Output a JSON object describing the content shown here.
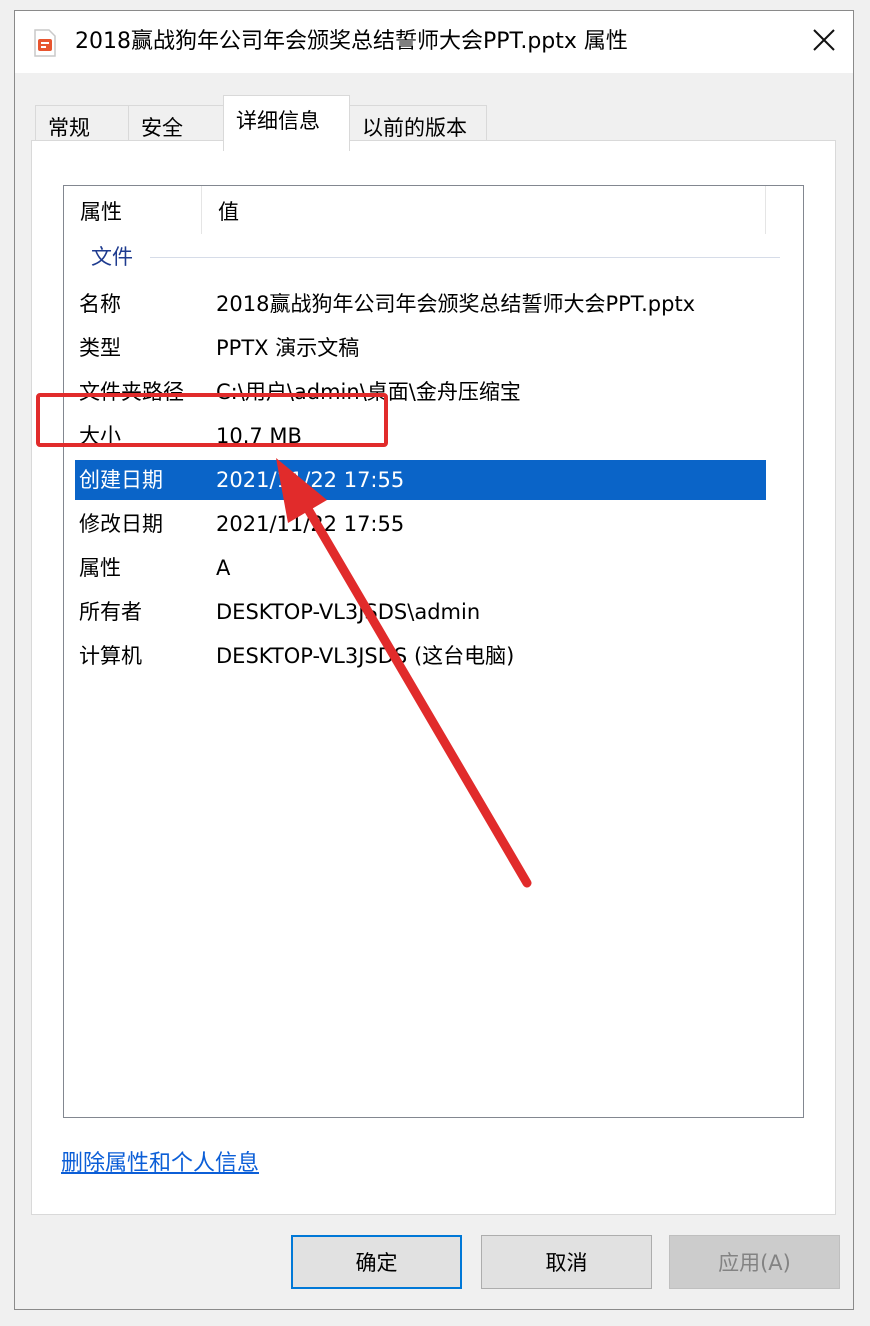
{
  "window": {
    "title": "2018赢战狗年公司年会颁奖总结誓师大会PPT.pptx 属性"
  },
  "tabs": [
    {
      "label": "常规"
    },
    {
      "label": "安全"
    },
    {
      "label": "详细信息"
    },
    {
      "label": "以前的版本"
    }
  ],
  "table": {
    "headers": {
      "property": "属性",
      "value": "值"
    },
    "group": "文件",
    "rows": [
      {
        "key": "名称",
        "value": "2018赢战狗年公司年会颁奖总结誓师大会PPT.pptx"
      },
      {
        "key": "类型",
        "value": "PPTX 演示文稿"
      },
      {
        "key": "文件夹路径",
        "value": "C:\\用户\\admin\\桌面\\金舟压缩宝"
      },
      {
        "key": "大小",
        "value": "10.7 MB"
      },
      {
        "key": "创建日期",
        "value": "2021/11/22 17:55"
      },
      {
        "key": "修改日期",
        "value": "2021/11/22 17:55"
      },
      {
        "key": "属性",
        "value": "A"
      },
      {
        "key": "所有者",
        "value": "DESKTOP-VL3JSDS\\admin"
      },
      {
        "key": "计算机",
        "value": "DESKTOP-VL3JSDS (这台电脑)"
      }
    ]
  },
  "links": {
    "remove_properties": "删除属性和个人信息"
  },
  "buttons": {
    "ok": "确定",
    "cancel": "取消",
    "apply": "应用(A)"
  },
  "colors": {
    "selection": "#0a64c8",
    "annotation": "#e12b2b",
    "link": "#0b5ed7"
  }
}
